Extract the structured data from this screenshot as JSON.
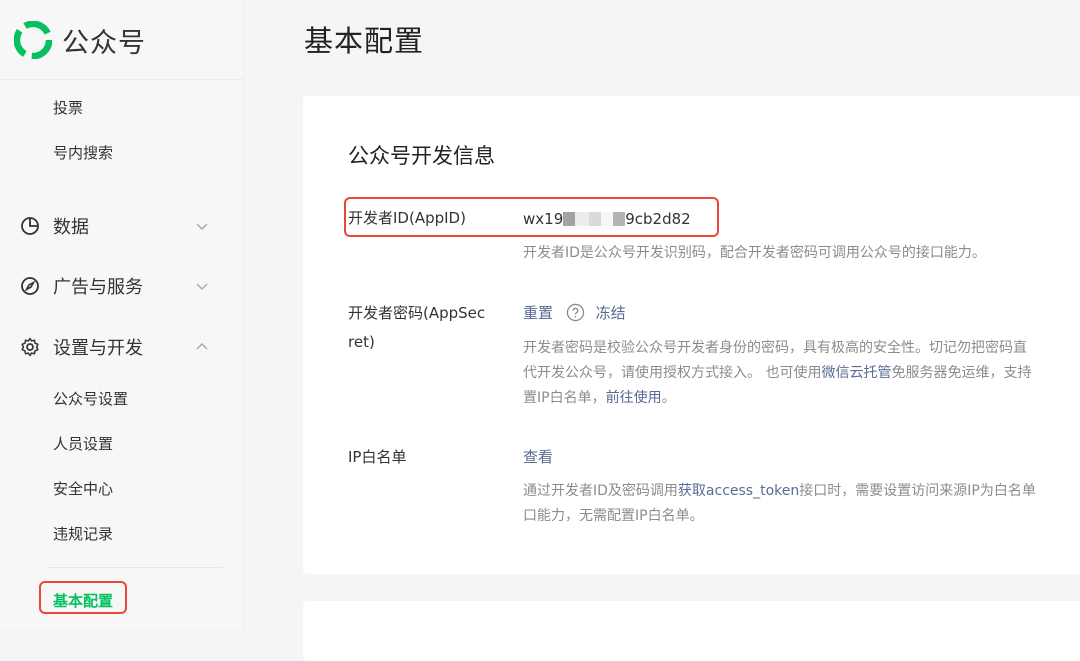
{
  "brand": {
    "name": "公众号",
    "color": "#07c160"
  },
  "sidebar": {
    "top_items": [
      {
        "label": "投票"
      },
      {
        "label": "号内搜索"
      }
    ],
    "groups": [
      {
        "label": "数据",
        "icon": "pie-chart-icon",
        "expanded": false
      },
      {
        "label": "广告与服务",
        "icon": "compass-icon",
        "expanded": false
      },
      {
        "label": "设置与开发",
        "icon": "gear-icon",
        "expanded": true
      }
    ],
    "settings_items": [
      {
        "label": "公众号设置"
      },
      {
        "label": "人员设置"
      },
      {
        "label": "安全中心"
      },
      {
        "label": "违规记录"
      }
    ],
    "active_item": {
      "label": "基本配置"
    }
  },
  "page": {
    "title": "基本配置"
  },
  "dev_info": {
    "section_title": "公众号开发信息",
    "appid": {
      "label": "开发者ID(AppID)",
      "value": "wx19",
      "value_suffix": "9cb2d82",
      "desc": "开发者ID是公众号开发识别码，配合开发者密码可调用公众号的接口能力。"
    },
    "secret": {
      "label_line1": "开发者密码(AppSec",
      "label_line2": "ret)",
      "reset": "重置",
      "freeze": "冻结",
      "desc_line1": "开发者密码是校验公众号开发者身份的密码，具有极高的安全性。切记勿把密码直",
      "desc_line2_a": "代开发公众号，请使用授权方式接入。 也可使用",
      "desc_line2_link": "微信云托管",
      "desc_line2_b": "免服务器免运维，支持",
      "desc_line3_a": "置IP白名单，",
      "desc_line3_link": "前往使用",
      "desc_line3_b": "。"
    },
    "ip_whitelist": {
      "label": "IP白名单",
      "view": "查看",
      "desc_line1_a": "通过开发者ID及密码调用",
      "desc_line1_link": "获取access_token",
      "desc_line1_b": "接口时，需要设置访问来源IP为白名单",
      "desc_line2": "口能力，无需配置IP白名单。"
    }
  },
  "colors": {
    "highlight_border": "#e8473a",
    "link": "#576b95",
    "desc": "#8c8c8c"
  }
}
